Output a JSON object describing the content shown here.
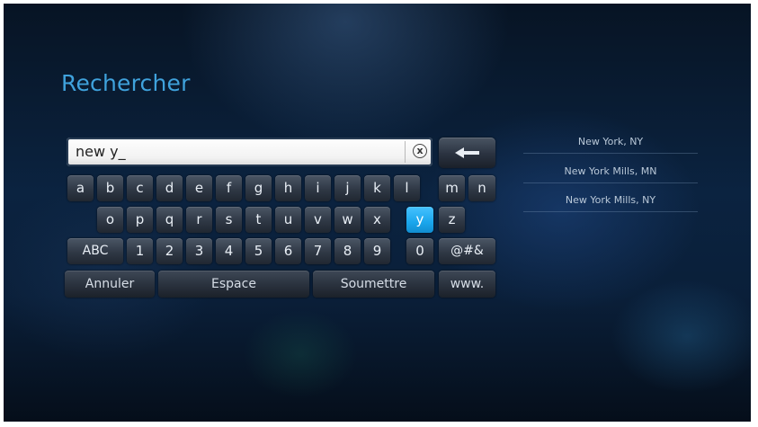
{
  "screen": {
    "title": "Rechercher"
  },
  "search": {
    "value": "new y_",
    "clear_symbol": "x"
  },
  "keyboard": {
    "row1": [
      "a",
      "b",
      "c",
      "d",
      "e",
      "f",
      "g",
      "h",
      "i",
      "j",
      "k",
      "l",
      "m",
      "n"
    ],
    "row2": [
      "o",
      "p",
      "q",
      "r",
      "s",
      "t",
      "u",
      "v",
      "w",
      "x",
      "y",
      "z"
    ],
    "row3": [
      "ABC",
      "1",
      "2",
      "3",
      "4",
      "5",
      "6",
      "7",
      "8",
      "9",
      "0",
      "@#&"
    ],
    "selected_key": "y",
    "bottom": {
      "cancel": "Annuler",
      "space": "Espace",
      "submit": "Soumettre",
      "www": "www."
    }
  },
  "suggestions": [
    "New York, NY",
    "New York Mills, MN",
    "New York Mills, NY"
  ],
  "colors": {
    "title": "#3fa2dc",
    "selected_key": "#1aa6ec"
  },
  "icons": {
    "backspace": "left-arrow-icon",
    "clear": "clear-circle-icon"
  }
}
